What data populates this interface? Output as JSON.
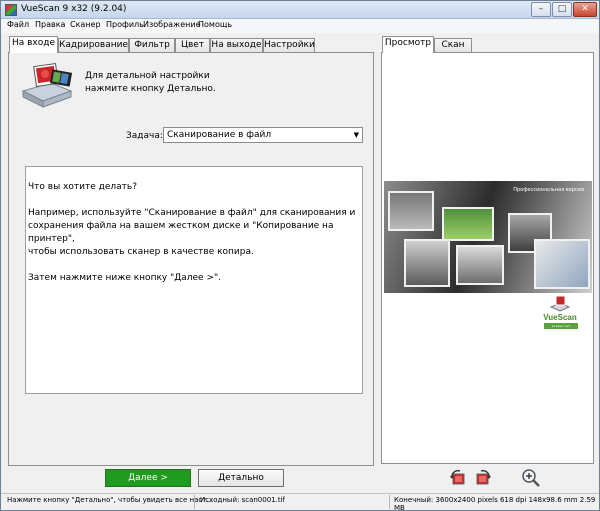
{
  "window": {
    "title": "VueScan 9 x32 (9.2.04)"
  },
  "menu": [
    "Файл",
    "Правка",
    "Сканер",
    "Профиль",
    "Изображение",
    "Помощь"
  ],
  "left_tabs": [
    "На входе",
    "Кадрирование",
    "Фильтр",
    "Цвет",
    "На выходе",
    "Настройки"
  ],
  "right_tabs": [
    "Просмотр",
    "Скан"
  ],
  "input_panel": {
    "hint_line1": "Для детальной настройки",
    "hint_line2": "нажмите кнопку Детально.",
    "task_label": "Задача:",
    "task_value": "Сканирование в файл",
    "help_q": "Что вы хотите делать?",
    "help_p1a": "Например, используйте \"Сканирование в файл\" для сканирования и",
    "help_p1b": "сохранения файла на вашем жестком диске и \"Копирование на принтер\",",
    "help_p1c": "чтобы использовать сканер в качестве копира.",
    "help_p2": "Затем нажмите ниже кнопку \"Далее >\"."
  },
  "buttons": {
    "next": "Далее >",
    "detail": "Детально"
  },
  "preview": {
    "caption": "Профессиональная версия",
    "logo": "VueScan",
    "logo_sub": "за ваш счет"
  },
  "status": {
    "left": "Нажмите кнопку \"Детально\", чтобы увидеть все наст...",
    "source": "Исходный: scan0001.tif",
    "output": "Конечный: 3600x2400 pixels 618 dpi 148x98.6 mm 2.59 MB"
  }
}
